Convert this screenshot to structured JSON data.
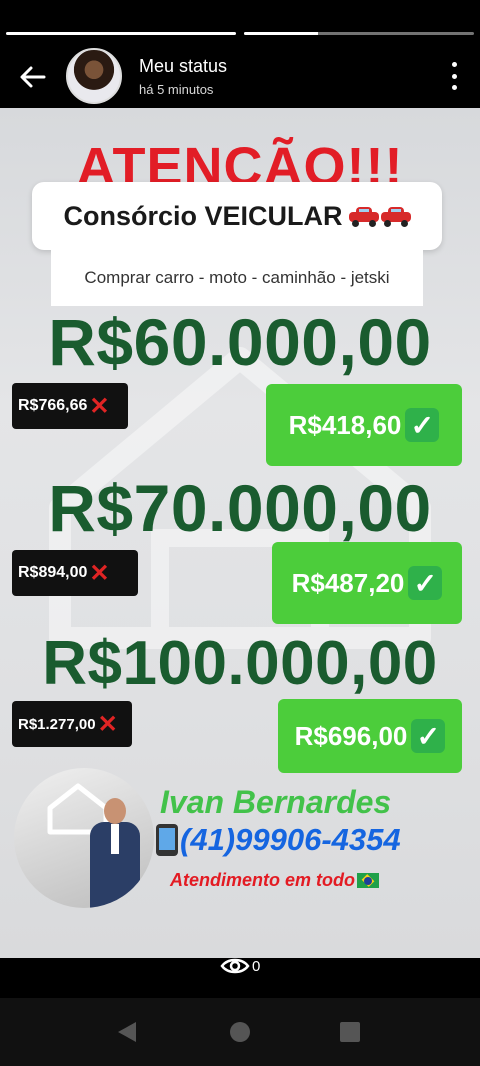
{
  "status": {
    "title": "Meu status",
    "time": "há 5 minutos",
    "progress": [
      1.0,
      0.32
    ],
    "views": "0"
  },
  "ad": {
    "headline": "ATENÇÃO!!!",
    "subtitle": "Consórcio VEICULAR",
    "types": "Comprar carro - moto - caminhão - jetski",
    "offers": [
      {
        "credit": "R$60.000,00",
        "old": "R$766,66",
        "new": "R$418,60"
      },
      {
        "credit": "R$70.000,00",
        "old": "R$894,00",
        "new": "R$487,20"
      },
      {
        "credit": "R$100.000,00",
        "old": "R$1.277,00",
        "new": "R$696,00"
      }
    ],
    "agent_name": "Ivan Bernardes",
    "phone": "(41)99906-4354",
    "service": "Atendimento em todo"
  },
  "colors": {
    "headline": "#e21d26",
    "price": "#1a5c2f",
    "new_box": "#4ccd3b",
    "name": "#42c24a",
    "phone": "#1565e0"
  }
}
